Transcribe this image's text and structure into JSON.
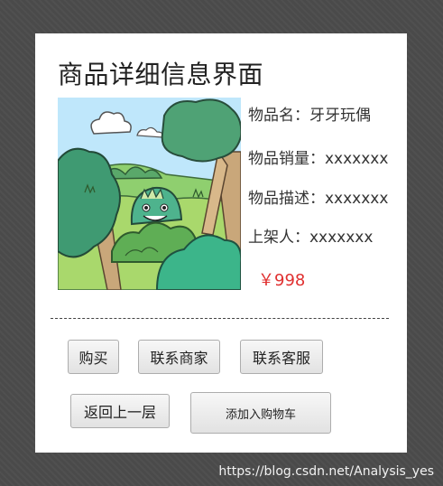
{
  "page": {
    "title": "商品详细信息界面"
  },
  "product": {
    "image_icon": "dinosaur-in-forest-illustration",
    "name_label": "物品名：",
    "name_value": "牙牙玩偶",
    "sales_label": "物品销量：",
    "sales_value": "xxxxxxx",
    "description_label": "物品描述：",
    "description_value": "xxxxxxx",
    "seller_label": "上架人：",
    "seller_value": "xxxxxxx",
    "price": "￥998",
    "price_color": "#e03030"
  },
  "actions": {
    "buy": "购买",
    "contact_seller": "联系商家",
    "contact_support": "联系客服",
    "back": "返回上一层",
    "add_to_cart": "添加入购物车"
  },
  "watermark": "https://blog.csdn.net/Analysis_yes"
}
